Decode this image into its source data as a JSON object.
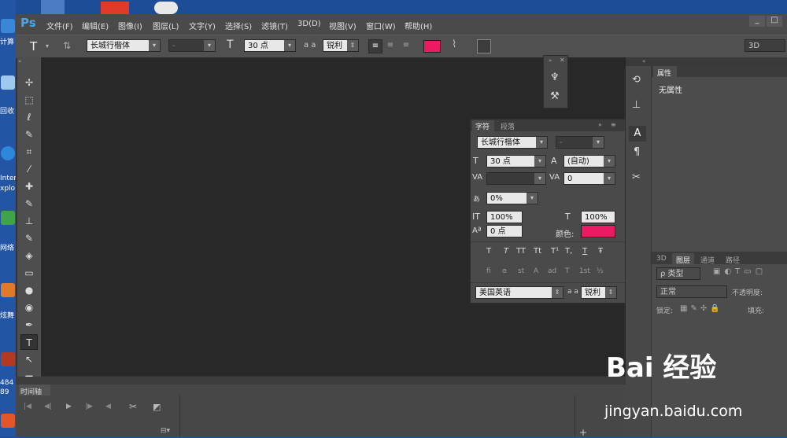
{
  "menu": {
    "logo": "Ps",
    "items": [
      "文件(F)",
      "编辑(E)",
      "图像(I)",
      "图层(L)",
      "文字(Y)",
      "选择(S)",
      "滤镜(T)",
      "3D(D)",
      "视图(V)",
      "窗口(W)",
      "帮助(H)"
    ]
  },
  "options": {
    "tool_label": "T",
    "font_family": "长城行楷体",
    "font_style": "-",
    "font_size": "30 点",
    "aa_label": "a a",
    "aa_value": "锐利",
    "color": "#ec1a63",
    "workspace": "3D"
  },
  "properties": {
    "tab": "属性",
    "content": "无属性"
  },
  "character": {
    "tabs": [
      "字符",
      "段落"
    ],
    "font_family": "长城行楷体",
    "font_style": "-",
    "size": "30 点",
    "leading": "(自动)",
    "kerning": "",
    "tracking": "0",
    "scale_pct": "0%",
    "vscale": "100%",
    "hscale": "100%",
    "baseline": "0 点",
    "color_label": "颜色:",
    "color": "#ec1a63",
    "style_buttons": [
      "T",
      "T",
      "TT",
      "Tt",
      "T¹",
      "T,",
      "T",
      "Ŧ"
    ],
    "ot_buttons": [
      "fi",
      "ɞ",
      "st",
      "A",
      "ad",
      "T",
      "1st",
      "½"
    ],
    "language": "美国英语",
    "aa_label": "a a",
    "aa_value": "锐利"
  },
  "layers": {
    "tabs": [
      "3D",
      "图层",
      "通道",
      "路径"
    ],
    "filter_kind": "ρ 类型",
    "blend_mode": "正常",
    "opacity_label": "不透明度:",
    "lock_label": "锁定:",
    "fill_label": "填充:"
  },
  "timeline": {
    "tab": "时间轴"
  },
  "desktop": {
    "labels": [
      "计算",
      "回收",
      "Inter",
      "xplo",
      "网络",
      "炫舞",
      "484",
      "89"
    ]
  },
  "watermark": {
    "brand": "Bai 经验",
    "url": "jingyan.baidu.com"
  },
  "window_buttons": [
    "_",
    "□",
    "×"
  ]
}
